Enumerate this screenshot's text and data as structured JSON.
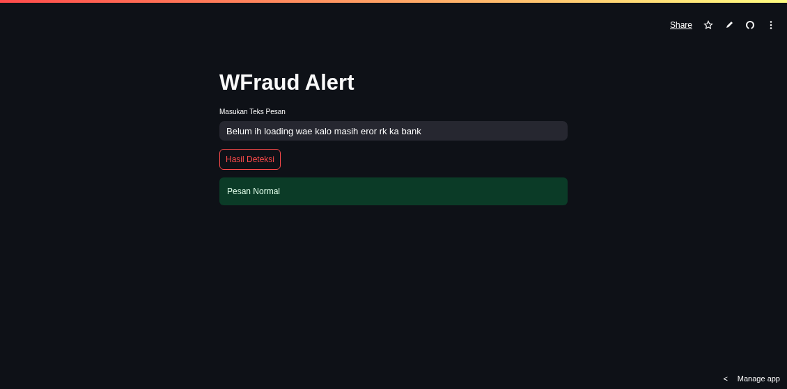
{
  "toolbar": {
    "share": "Share"
  },
  "title": "WFraud Alert",
  "input": {
    "label": "Masukan Teks Pesan",
    "value": "Belum ih loading wae kalo masih eror rk ka bank"
  },
  "button": "Hasil Deteksi",
  "alert": {
    "kind": "success",
    "text": "Pesan Normal"
  },
  "footer": {
    "arrow": "<",
    "label": "Manage app"
  }
}
